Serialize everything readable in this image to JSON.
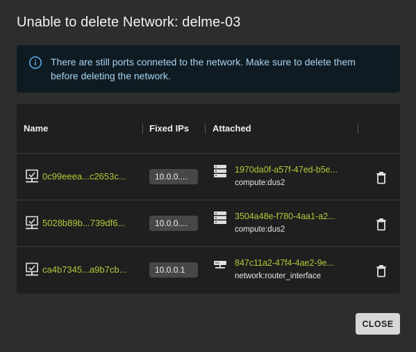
{
  "dialog": {
    "title": "Unable to delete Network: delme-03",
    "alert": {
      "icon": "info-icon",
      "text": "There are still ports conneted to the network. Make sure to delete them before deleting the network."
    },
    "table": {
      "columns": [
        "Name",
        "Fixed IPs",
        "Attached"
      ],
      "rows": [
        {
          "name": "0c99eeea...c2653c...",
          "fixed_ip": "10.0.0....",
          "device_id": "1970da0f-a57f-47ed-b5e...",
          "device_owner": "compute:dus2",
          "device_icon": "server-icon"
        },
        {
          "name": "5028b89b...739df6...",
          "fixed_ip": "10.0.0....",
          "device_id": "3504a48e-f780-4aa1-a2...",
          "device_owner": "compute:dus2",
          "device_icon": "server-icon"
        },
        {
          "name": "ca4b7345...a9b7cb...",
          "fixed_ip": "10.0.0.1",
          "device_id": "847c11a2-47f4-4ae2-9e...",
          "device_owner": "network:router_interface",
          "device_icon": "router-icon"
        }
      ]
    },
    "close_label": "CLOSE"
  },
  "colors": {
    "background": "#2d2d2d",
    "alert_bg": "#0f1b22",
    "alert_text": "#a9d4f2",
    "link": "#b5c93a",
    "table_bg": "#1f1f1f",
    "chip_bg": "#474747",
    "button_bg": "#d7d7d7"
  }
}
